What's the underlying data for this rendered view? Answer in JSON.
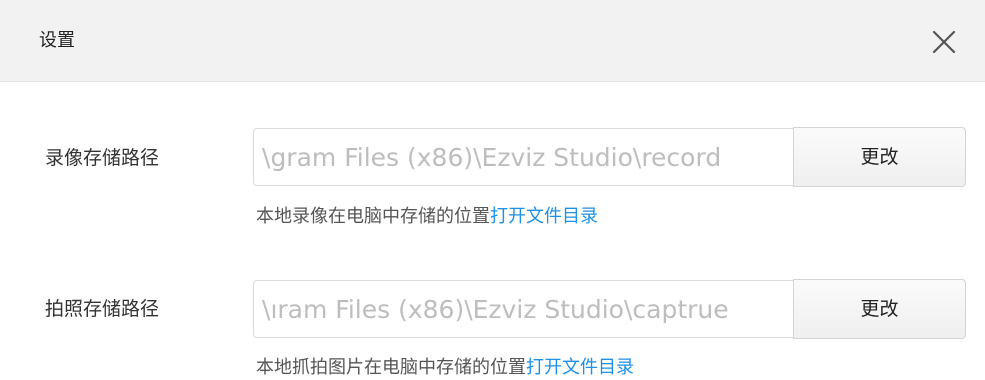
{
  "dialog": {
    "title": "设置",
    "close_icon": "close-icon"
  },
  "record": {
    "label": "录像存储路径",
    "path": "gram Files (x86)\\Ezviz Studio\\record\\",
    "change_label": "更改",
    "hint_text": "本地录像在电脑中存储的位置",
    "open_link": "打开文件目录"
  },
  "capture": {
    "label": "拍照存储路径",
    "path": "ıram Files (x86)\\Ezviz Studio\\captrue\\",
    "change_label": "更改",
    "hint_text": "本地抓拍图片在电脑中存储的位置",
    "open_link": "打开文件目录"
  },
  "colors": {
    "link": "#1e90e6",
    "title_bar_bg": "#f2f2f2",
    "input_text": "#bdbdbd"
  }
}
